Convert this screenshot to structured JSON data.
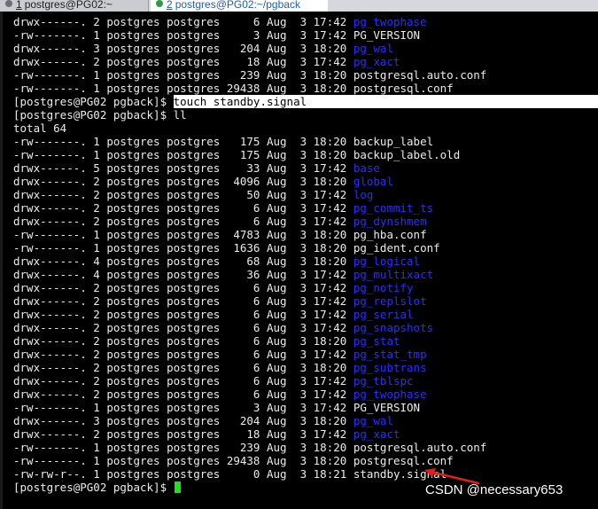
{
  "tabs": [
    {
      "number": "1",
      "title": "postgres@PG02:~",
      "active": false
    },
    {
      "number": "2",
      "title": "postgres@PG02:~/pgback",
      "active": true
    }
  ],
  "terminal": {
    "lines": [
      {
        "text": "drwx------. 2 postgres postgres     6 Aug  3 17:42 ",
        "name": "pg_twophase",
        "kind": "dir"
      },
      {
        "text": "-rw-------. 1 postgres postgres     3 Aug  3 17:42 ",
        "name": "PG_VERSION",
        "kind": "file"
      },
      {
        "text": "drwx------. 3 postgres postgres   204 Aug  3 18:20 ",
        "name": "pg_wal",
        "kind": "dir"
      },
      {
        "text": "drwx------. 2 postgres postgres    18 Aug  3 17:42 ",
        "name": "pg_xact",
        "kind": "dir"
      },
      {
        "text": "-rw-------. 1 postgres postgres   239 Aug  3 18:20 ",
        "name": "postgresql.auto.conf",
        "kind": "file"
      },
      {
        "text": "-rw-------. 1 postgres postgres 29438 Aug  3 18:20 ",
        "name": "postgresql.conf",
        "kind": "file"
      },
      {
        "text": "[postgres@PG02 pgback]$ ",
        "name": "touch standby.signal",
        "kind": "prompt-hl"
      },
      {
        "text": "[postgres@PG02 pgback]$ ",
        "name": "ll",
        "kind": "prompt"
      },
      {
        "text": "total 64",
        "name": "",
        "kind": "plain"
      },
      {
        "text": "-rw-------. 1 postgres postgres   175 Aug  3 18:20 ",
        "name": "backup_label",
        "kind": "file"
      },
      {
        "text": "-rw-------. 1 postgres postgres   175 Aug  3 18:20 ",
        "name": "backup_label.old",
        "kind": "file"
      },
      {
        "text": "drwx------. 5 postgres postgres    33 Aug  3 17:42 ",
        "name": "base",
        "kind": "dir"
      },
      {
        "text": "drwx------. 2 postgres postgres  4096 Aug  3 18:20 ",
        "name": "global",
        "kind": "dir"
      },
      {
        "text": "drwx------. 2 postgres postgres    50 Aug  3 17:42 ",
        "name": "log",
        "kind": "dir"
      },
      {
        "text": "drwx------. 2 postgres postgres     6 Aug  3 17:42 ",
        "name": "pg_commit_ts",
        "kind": "dir"
      },
      {
        "text": "drwx------. 2 postgres postgres     6 Aug  3 17:42 ",
        "name": "pg_dynshmem",
        "kind": "dir"
      },
      {
        "text": "-rw-------. 1 postgres postgres  4783 Aug  3 18:20 ",
        "name": "pg_hba.conf",
        "kind": "file"
      },
      {
        "text": "-rw-------. 1 postgres postgres  1636 Aug  3 18:20 ",
        "name": "pg_ident.conf",
        "kind": "file"
      },
      {
        "text": "drwx------. 4 postgres postgres    68 Aug  3 18:20 ",
        "name": "pg_logical",
        "kind": "dir"
      },
      {
        "text": "drwx------. 4 postgres postgres    36 Aug  3 17:42 ",
        "name": "pg_multixact",
        "kind": "dir"
      },
      {
        "text": "drwx------. 2 postgres postgres     6 Aug  3 17:42 ",
        "name": "pg_notify",
        "kind": "dir"
      },
      {
        "text": "drwx------. 2 postgres postgres     6 Aug  3 17:42 ",
        "name": "pg_replslot",
        "kind": "dir"
      },
      {
        "text": "drwx------. 2 postgres postgres     6 Aug  3 17:42 ",
        "name": "pg_serial",
        "kind": "dir"
      },
      {
        "text": "drwx------. 2 postgres postgres     6 Aug  3 17:42 ",
        "name": "pg_snapshots",
        "kind": "dir"
      },
      {
        "text": "drwx------. 2 postgres postgres     6 Aug  3 18:20 ",
        "name": "pg_stat",
        "kind": "dir"
      },
      {
        "text": "drwx------. 2 postgres postgres     6 Aug  3 17:42 ",
        "name": "pg_stat_tmp",
        "kind": "dir"
      },
      {
        "text": "drwx------. 2 postgres postgres     6 Aug  3 18:20 ",
        "name": "pg_subtrans",
        "kind": "dir"
      },
      {
        "text": "drwx------. 2 postgres postgres     6 Aug  3 17:42 ",
        "name": "pg_tblspc",
        "kind": "dir"
      },
      {
        "text": "drwx------. 2 postgres postgres     6 Aug  3 17:42 ",
        "name": "pg_twophase",
        "kind": "dir"
      },
      {
        "text": "-rw-------. 1 postgres postgres     3 Aug  3 17:42 ",
        "name": "PG_VERSION",
        "kind": "file"
      },
      {
        "text": "drwx------. 3 postgres postgres   204 Aug  3 18:20 ",
        "name": "pg_wal",
        "kind": "dir"
      },
      {
        "text": "drwx------. 2 postgres postgres    18 Aug  3 17:42 ",
        "name": "pg_xact",
        "kind": "dir"
      },
      {
        "text": "-rw-------. 1 postgres postgres   239 Aug  3 18:20 ",
        "name": "postgresql.auto.conf",
        "kind": "file"
      },
      {
        "text": "-rw-------. 1 postgres postgres 29438 Aug  3 18:20 ",
        "name": "postgresql.conf",
        "kind": "file"
      },
      {
        "text": "-rw-rw-r--. 1 postgres postgres     0 Aug  3 18:21 ",
        "name": "standby.signal",
        "kind": "file"
      },
      {
        "text": "[postgres@PG02 pgback]$ ",
        "name": "",
        "kind": "cursor"
      }
    ]
  },
  "annotation": {
    "icon": "red-arrow-icon",
    "color": "#e0201b"
  },
  "watermark": "CSDN @necessary653",
  "colors": {
    "background": "#000000",
    "text": "#ececec",
    "directory": "#2d2dff",
    "cursor": "#20e020"
  }
}
